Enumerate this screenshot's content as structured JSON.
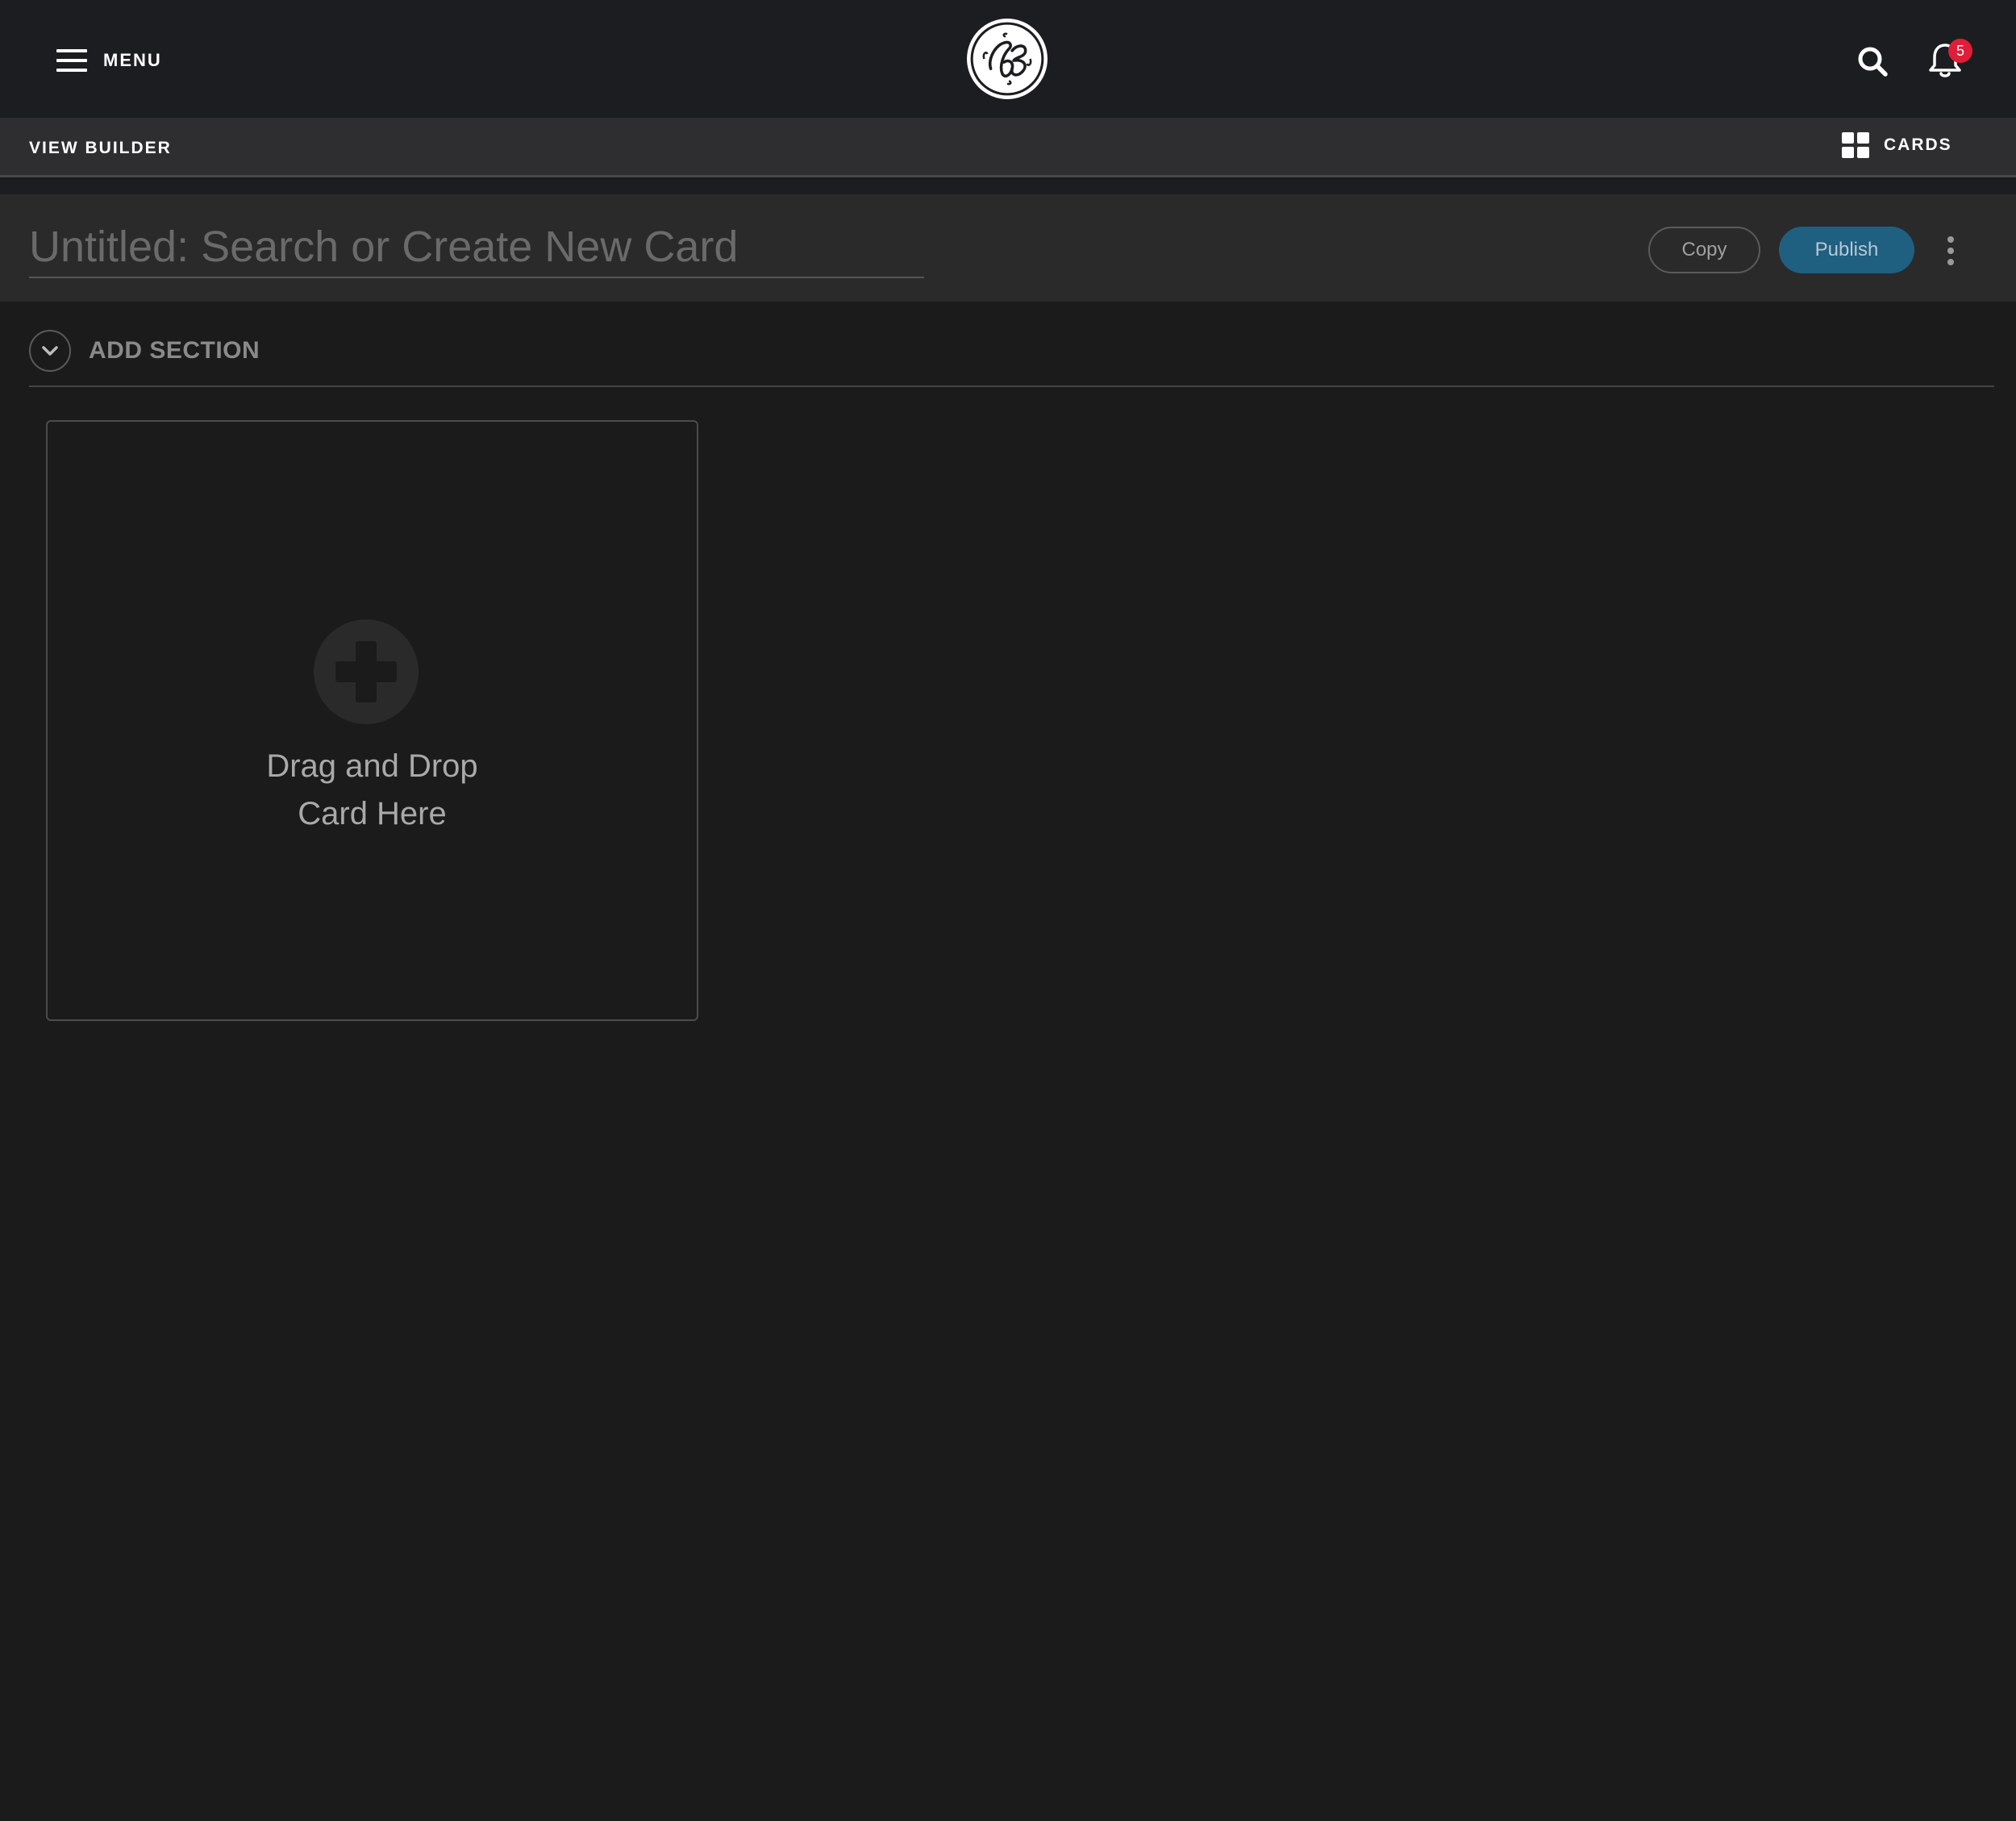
{
  "header": {
    "menu_label": "MENU",
    "logo_icon": "ge-logo-icon",
    "notification_count": "5"
  },
  "subheader": {
    "title": "VIEW BUILDER",
    "cards_label": "CARDS"
  },
  "editor": {
    "title_placeholder": "Untitled: Search or Create New Card",
    "title_value": "",
    "copy_label": "Copy",
    "publish_label": "Publish"
  },
  "section": {
    "add_section_label": "ADD SECTION"
  },
  "dropzone": {
    "line1": "Drag and Drop",
    "line2": "Card Here"
  },
  "colors": {
    "header_bg": "#1c1d21",
    "subheader_bg": "#2e2e30",
    "page_bg": "#1b1b1b",
    "publish_bg": "#1f5f80",
    "badge_bg": "#e01e37"
  }
}
